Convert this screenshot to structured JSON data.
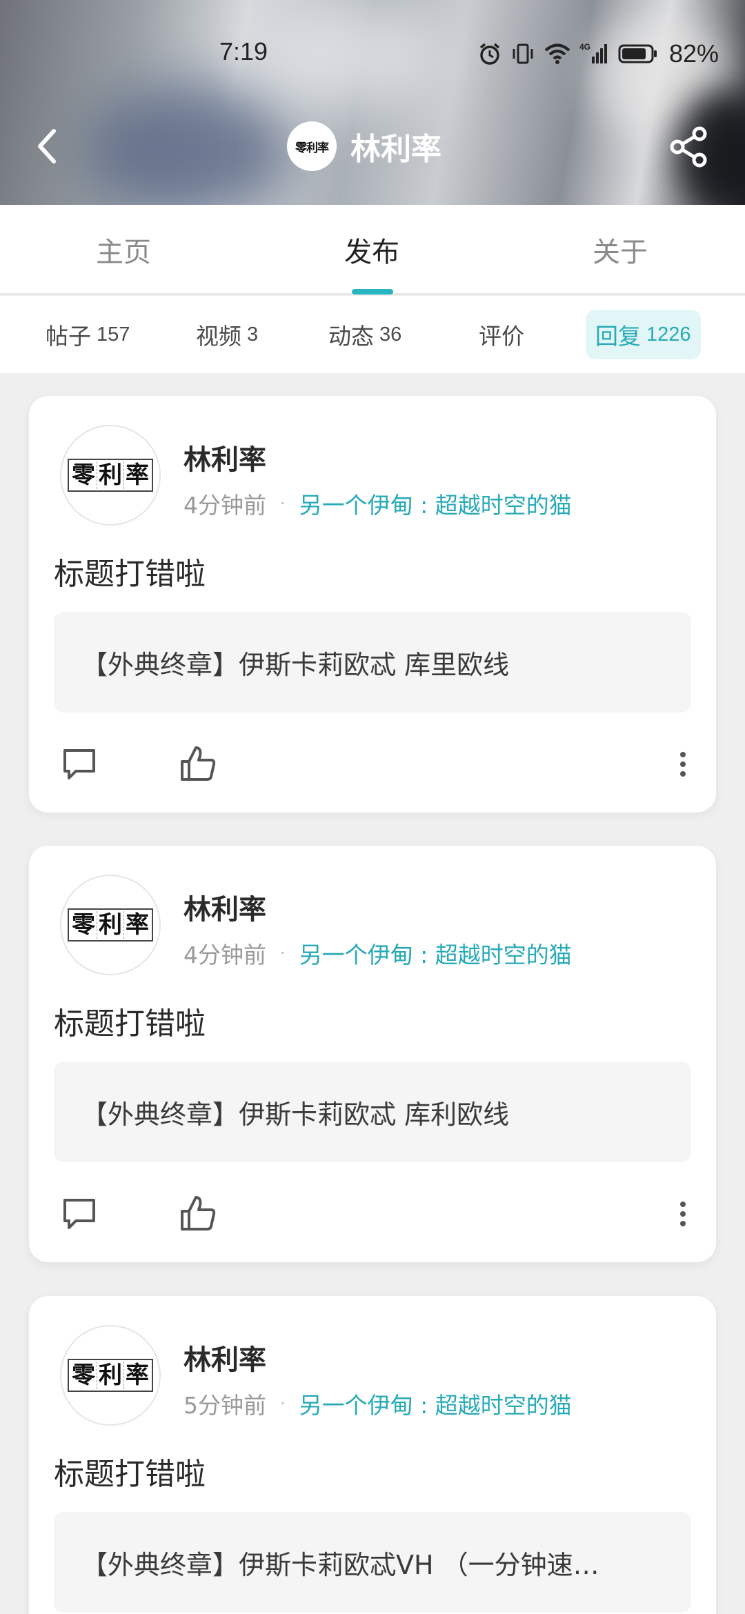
{
  "status_bar": {
    "time": "7:19",
    "battery": "82%",
    "network": "4G"
  },
  "header": {
    "avatar_text": "零利率",
    "profile_name": "林利率"
  },
  "tabs": [
    {
      "label": "主页"
    },
    {
      "label": "发布"
    },
    {
      "label": "关于"
    }
  ],
  "subtabs": [
    {
      "label": "帖子",
      "count": "157"
    },
    {
      "label": "视频",
      "count": "3"
    },
    {
      "label": "动态",
      "count": "36"
    },
    {
      "label": "评价",
      "count": ""
    },
    {
      "label": "回复",
      "count": "1226"
    }
  ],
  "posts": [
    {
      "avatar_text": [
        "零",
        "利",
        "率"
      ],
      "author": "林利率",
      "time": "4分钟前",
      "forum": "另一个伊甸 : 超越时空的猫",
      "title": "标题打错啦",
      "quote": "【外典终章】伊斯卡莉欧忒 库里欧线"
    },
    {
      "avatar_text": [
        "零",
        "利",
        "率"
      ],
      "author": "林利率",
      "time": "4分钟前",
      "forum": "另一个伊甸 : 超越时空的猫",
      "title": "标题打错啦",
      "quote": "【外典终章】伊斯卡莉欧忒 库利欧线"
    },
    {
      "avatar_text": [
        "零",
        "利",
        "率"
      ],
      "author": "林利率",
      "time": "5分钟前",
      "forum": "另一个伊甸 : 超越时空的猫",
      "title": "标题打错啦",
      "quote": "【外典终章】伊斯卡莉欧忒VH （一分钟速…"
    }
  ],
  "colors": {
    "accent": "#27b5c2",
    "forum_text": "#27aab7",
    "active_subtab_bg": "#e3f6f7",
    "page_bg": "#efefef"
  },
  "icons": [
    "back-icon",
    "share-icon",
    "comment-icon",
    "like-icon",
    "more-icon",
    "alarm-icon",
    "vibrate-icon",
    "wifi-icon",
    "signal-icon",
    "battery-icon"
  ]
}
